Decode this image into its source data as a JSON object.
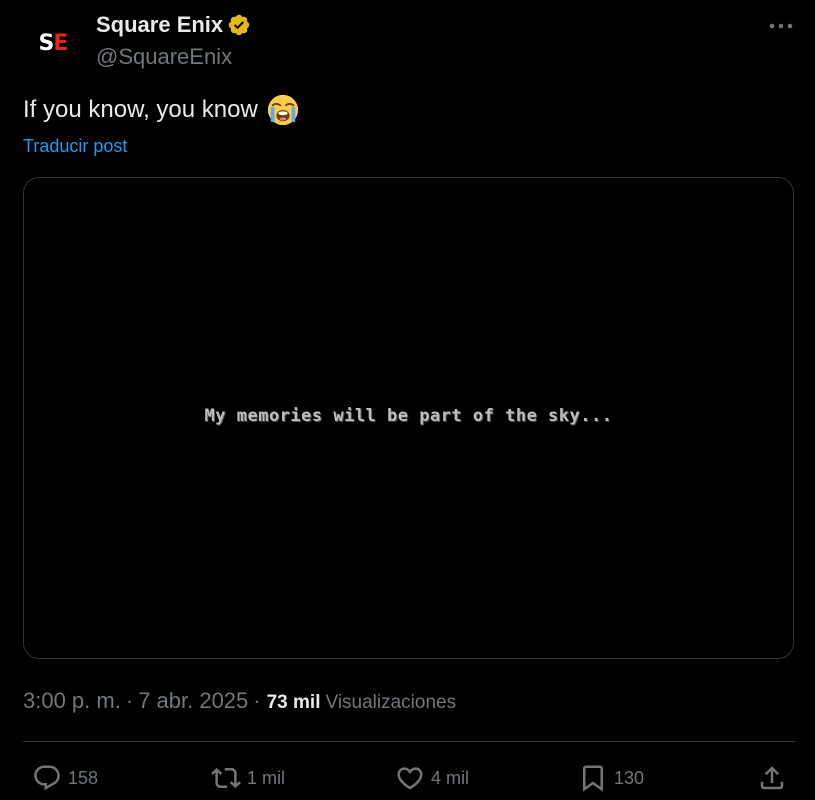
{
  "author": {
    "avatar_text_left": "S",
    "avatar_text_right": "E",
    "display_name": "Square Enix",
    "handle": "@SquareEnix",
    "verified_color": "#e2b719",
    "avatar_accent_color": "#e1251b"
  },
  "post": {
    "text": "If you know, you know",
    "emoji": "loudly-crying-face",
    "translate_label": "Traducir post",
    "media_caption": "My memories will be part of the sky..."
  },
  "meta": {
    "time": "3:00 p. m.",
    "separator": "·",
    "date": "7 abr. 2025",
    "views_count": "73 mil",
    "views_label": "Visualizaciones"
  },
  "actions": {
    "replies": "158",
    "reposts": "1 mil",
    "likes": "4 mil",
    "bookmarks": "130"
  },
  "colors": {
    "background": "#000000",
    "text": "#e7e9ea",
    "muted": "#71767b",
    "link": "#1d9bf0",
    "border": "#2f3336"
  }
}
